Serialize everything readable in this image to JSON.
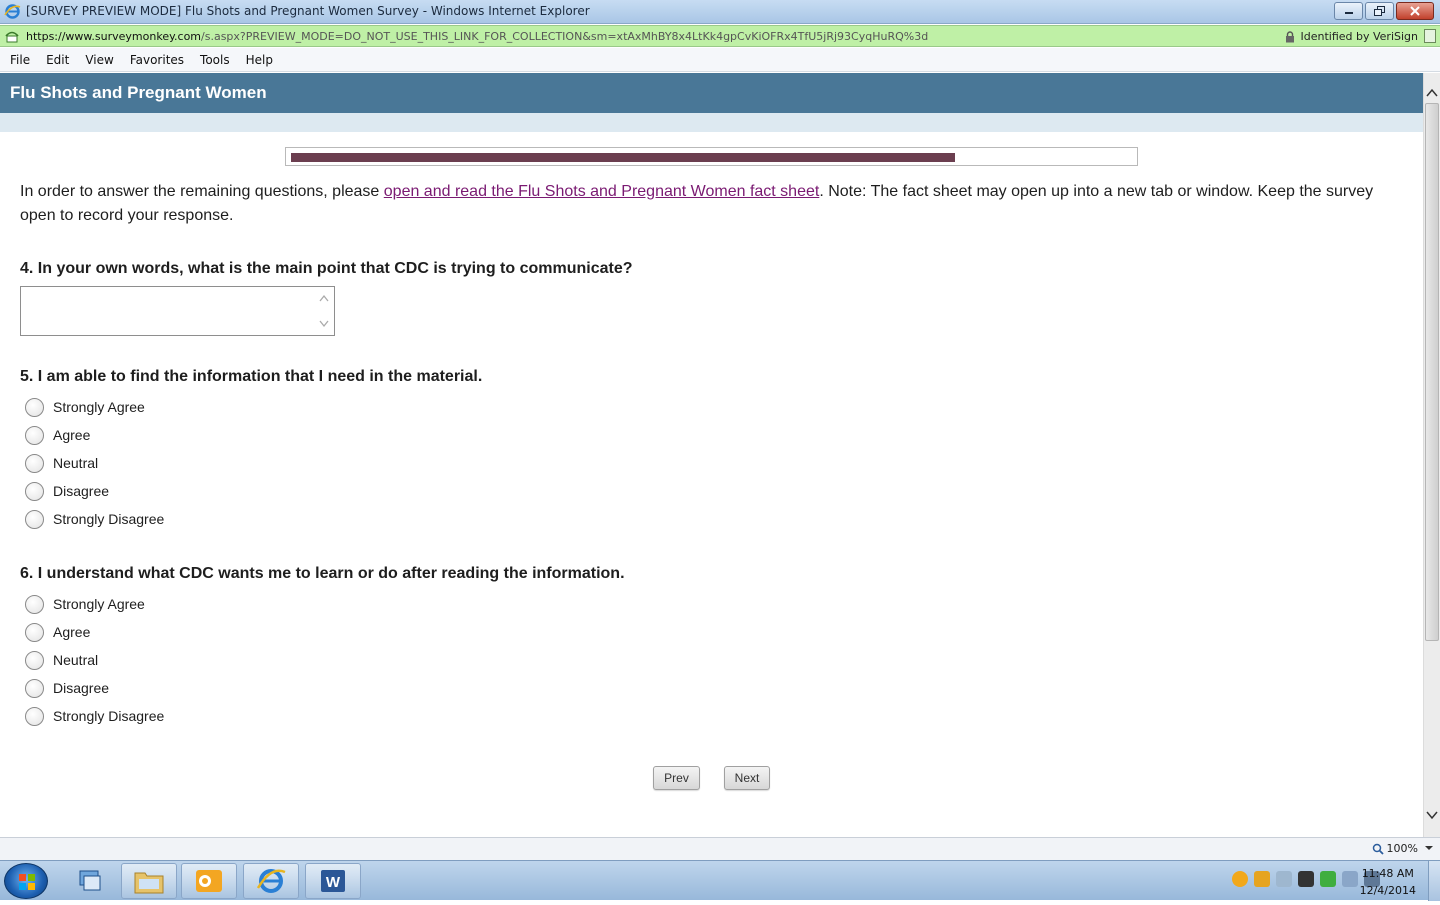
{
  "window": {
    "title": "[SURVEY PREVIEW MODE] Flu Shots and Pregnant Women Survey - Windows Internet Explorer"
  },
  "address": {
    "url_domain": "https://www.surveymonkey.com",
    "url_path": "/s.aspx?PREVIEW_MODE=DO_NOT_USE_THIS_LINK_FOR_COLLECTION&sm=xtAxMhBY8x4LtKk4gpCvKiOFRx4TfU5jRj93CyqHuRQ%3d",
    "identity": "Identified by VeriSign"
  },
  "menu": {
    "file": "File",
    "edit": "Edit",
    "view": "View",
    "favorites": "Favorites",
    "tools": "Tools",
    "help": "Help"
  },
  "survey": {
    "title": "Flu Shots and Pregnant Women",
    "progress_fraction": 0.79,
    "intro_before": "In order to answer the remaining questions, please ",
    "intro_link": "open and read the Flu Shots and Pregnant Women fact sheet",
    "intro_after": ". Note: The fact sheet may open up into a new tab or window. Keep the survey open to record your response.",
    "q4": {
      "title": "4. In your own words, what is the main point that CDC is trying to communicate?",
      "value": ""
    },
    "q5": {
      "title": "5. I am able to find the information that I need in the material.",
      "options": [
        "Strongly Agree",
        "Agree",
        "Neutral",
        "Disagree",
        "Strongly Disagree"
      ]
    },
    "q6": {
      "title": "6. I understand what CDC wants me to learn or do after reading the information.",
      "options": [
        "Strongly Agree",
        "Agree",
        "Neutral",
        "Disagree",
        "Strongly Disagree"
      ]
    },
    "prev_label": "Prev",
    "next_label": "Next"
  },
  "status": {
    "zoom": "100%"
  },
  "taskbar": {
    "time": "11:48 AM",
    "date": "12/4/2014"
  },
  "colors": {
    "header": "#497797",
    "progress": "#6b3e4f",
    "link": "#7a1a72",
    "address_secure": "#bff0a6"
  }
}
